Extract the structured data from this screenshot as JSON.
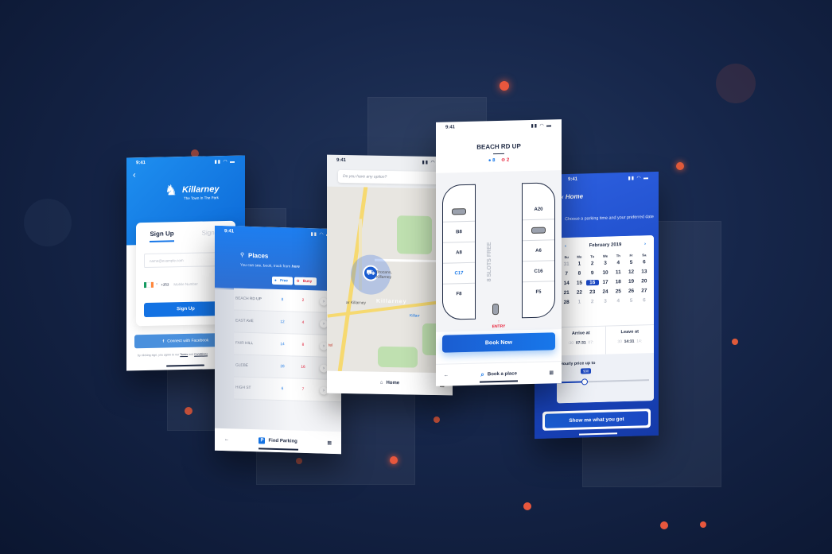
{
  "signup": {
    "time": "9:41",
    "brand": "Killarney",
    "tagline": "The Town In The Park",
    "tab_signup": "Sign Up",
    "tab_signin": "Sign In",
    "email_placeholder": "name@example.com",
    "country_code": "+353",
    "mobile_placeholder": "Mobile Number",
    "signup_button": "Sign Up",
    "facebook_button": "Connect with Facebook",
    "terms_prefix": "by clicking sign, you agree to our",
    "terms_link": "Terms",
    "terms_and": "and",
    "conditions_link": "Conditions"
  },
  "places": {
    "title": "Places",
    "subtitle": "You can see, book, track from",
    "subtitle_here": "here",
    "legend_free": "Free",
    "legend_busy": "Busy",
    "rows": [
      {
        "name": "BEACH RD UP",
        "free": "8",
        "busy": "2"
      },
      {
        "name": "EAST AVE",
        "free": "12",
        "busy": "4"
      },
      {
        "name": "FAIR HILL",
        "free": "14",
        "busy": "8"
      },
      {
        "name": "GLEBE",
        "free": "28",
        "busy": "16"
      },
      {
        "name": "HIGH ST",
        "free": "6",
        "busy": "7"
      }
    ],
    "nav_label": "Find Parking"
  },
  "map": {
    "time": "9:41",
    "search_placeholder": "Do you have any option?",
    "label_town": "Killarney",
    "label_poi1": "Brocans, Killarney",
    "label_poi2": "ar Killarney",
    "label_poi3": "Killarr",
    "label_poi4": "tel",
    "nav_label": "Home"
  },
  "lot": {
    "time": "9:41",
    "title": "BEACH RD UP",
    "free_count": "8",
    "busy_count": "2",
    "left_slots": [
      "",
      "B8",
      "A8",
      "C17",
      "F8"
    ],
    "right_slots": [
      "A20",
      "",
      "A6",
      "C16",
      "F5"
    ],
    "slots_free": "8 SLOTS FREE",
    "entry": "ENTRY",
    "book_button": "Book Now",
    "nav_label": "Book a place"
  },
  "calendar": {
    "time": "9:41",
    "back": "Home",
    "prompt": "Choose a parking time and your preferred date",
    "month": "February 2019",
    "dows": [
      "Su",
      "Mo",
      "Tu",
      "We",
      "Th",
      "Fr",
      "Sa"
    ],
    "days": [
      [
        "31",
        "1",
        "2",
        "3",
        "4",
        "5",
        "6"
      ],
      [
        "7",
        "8",
        "9",
        "10",
        "11",
        "12",
        "13"
      ],
      [
        "14",
        "15",
        "16",
        "17",
        "18",
        "19",
        "20"
      ],
      [
        "21",
        "22",
        "23",
        "24",
        "25",
        "26",
        "27"
      ],
      [
        "28",
        "1",
        "2",
        "3",
        "4",
        "5",
        "6"
      ]
    ],
    "selected_day": "16",
    "arrive_label": "Arrive at",
    "leave_label": "Leave at",
    "arrive_times": [
      ":30",
      "07:31",
      "07:"
    ],
    "leave_times": [
      "30",
      "14:31",
      "14:"
    ],
    "price_label": "Hourly price up to",
    "price_value": "$30",
    "price_level_percent": 30,
    "cta": "Show me what you got"
  }
}
